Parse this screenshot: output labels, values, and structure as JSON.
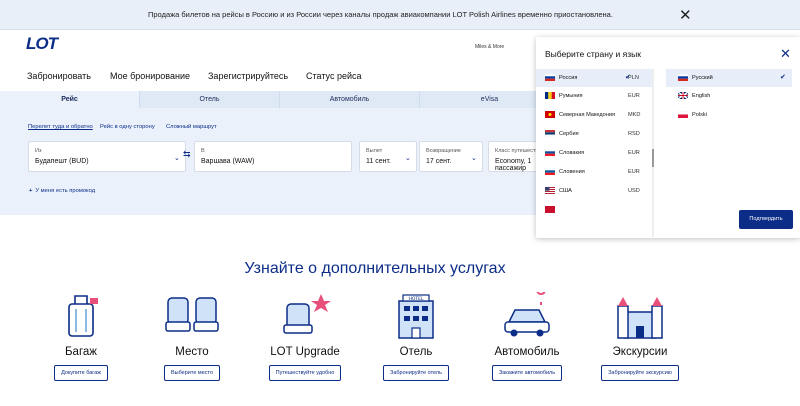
{
  "notice": {
    "text": "Продажа билетов на рейсы в Россию и из России через каналы продаж авиакомпании LOT Polish Airlines временно приостановлена.",
    "close": "✕"
  },
  "header": {
    "logo": "LOT",
    "miles": "Miles & More"
  },
  "nav": [
    "Забронировать",
    "Мое бронирование",
    "Зарегистрируйтесь",
    "Статус рейса"
  ],
  "tabs": [
    "Рейс",
    "Отель",
    "Автомобиль",
    "eVisa"
  ],
  "trip_types": [
    "Перелет туда и обратно",
    "Рейс в одну сторону",
    "Сложный маршрут"
  ],
  "search": {
    "from_label": "Из",
    "from_value": "Будапешт (BUD)",
    "to_label": "В",
    "to_value": "Варшава (WAW)",
    "depart_label": "Вылет",
    "depart_value": "11 сент.",
    "return_label": "Возвращение",
    "return_value": "17 сент.",
    "class_label": "Класс путешествия",
    "class_value": "Economy, 1 пассажир",
    "promo": "У меня есть промокод"
  },
  "services": {
    "title": "Узнайте о дополнительных услугах",
    "items": [
      {
        "title": "Багаж",
        "button": "Докупите багаж"
      },
      {
        "title": "Место",
        "button": "Выберите место"
      },
      {
        "title": "LOT Upgrade",
        "button": "Путешествуйте удобно"
      },
      {
        "title": "Отель",
        "button": "Забронируйте отель"
      },
      {
        "title": "Автомобиль",
        "button": "Закажите автомобиль"
      },
      {
        "title": "Экскурсии",
        "button": "Забронируйте экскурсию"
      }
    ]
  },
  "dropdown": {
    "title": "Выберите страну и язык",
    "close": "✕",
    "confirm": "Подтвердить",
    "countries": [
      {
        "name": "Россия",
        "currency": "PLN",
        "selected": true
      },
      {
        "name": "Румыния",
        "currency": "EUR"
      },
      {
        "name": "Северная Македония",
        "currency": "MKD"
      },
      {
        "name": "Сербия",
        "currency": "RSD"
      },
      {
        "name": "Словакия",
        "currency": "EUR"
      },
      {
        "name": "Словения",
        "currency": "EUR"
      },
      {
        "name": "США",
        "currency": "USD"
      }
    ],
    "languages": [
      {
        "name": "Русский",
        "selected": true
      },
      {
        "name": "English"
      },
      {
        "name": "Polski"
      }
    ]
  },
  "colors": {
    "brand": "#0c2d87",
    "panel": "#eaf1fb"
  }
}
